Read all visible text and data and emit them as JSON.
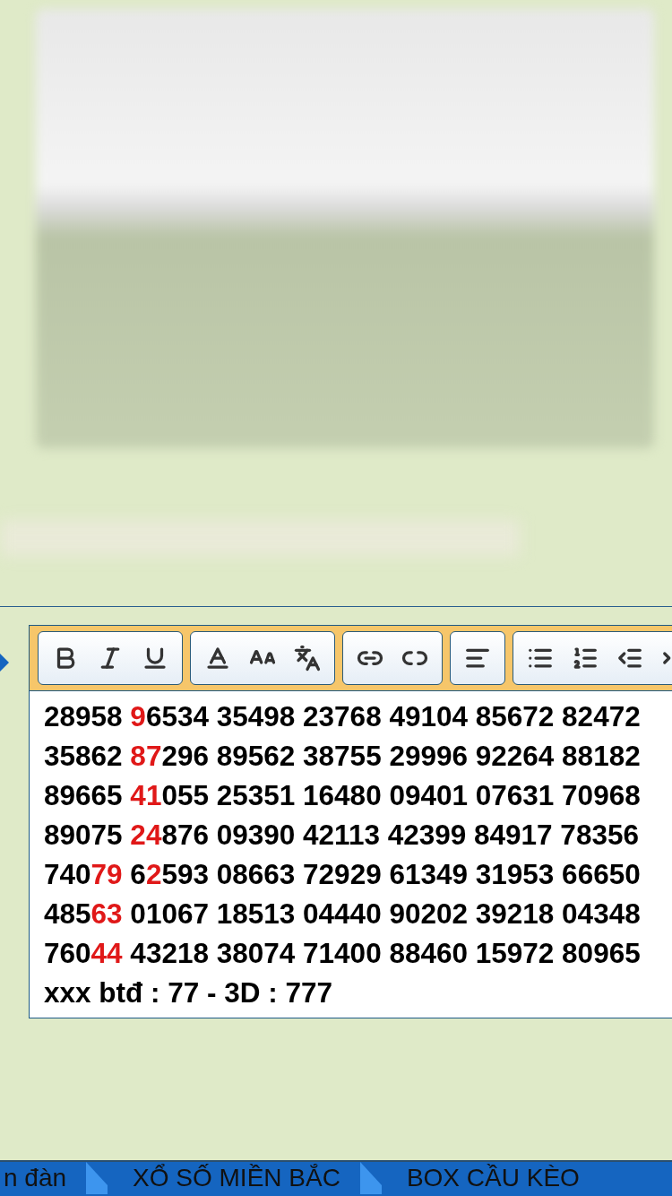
{
  "editor": {
    "lines": [
      [
        {
          "text": "28958 ",
          "highlight": false
        },
        {
          "text": "9",
          "highlight": true
        },
        {
          "text": "6534 35498 23768 49104 85672 82472",
          "highlight": false
        }
      ],
      [
        {
          "text": "35862 ",
          "highlight": false
        },
        {
          "text": "87",
          "highlight": true
        },
        {
          "text": "296 89562 38755 29996 92264 88182",
          "highlight": false
        }
      ],
      [
        {
          "text": "89665 ",
          "highlight": false
        },
        {
          "text": "41",
          "highlight": true
        },
        {
          "text": "055 25351 16480 09401 07631 70968",
          "highlight": false
        }
      ],
      [
        {
          "text": "89075 ",
          "highlight": false
        },
        {
          "text": "24",
          "highlight": true
        },
        {
          "text": "876 09390 42113 42399 84917 78356",
          "highlight": false
        }
      ],
      [
        {
          "text": "740",
          "highlight": false
        },
        {
          "text": "79",
          "highlight": true
        },
        {
          "text": " 6",
          "highlight": false
        },
        {
          "text": "2",
          "highlight": true
        },
        {
          "text": "593 08663 72929 61349 31953 66650",
          "highlight": false
        }
      ],
      [
        {
          "text": "485",
          "highlight": false
        },
        {
          "text": "63",
          "highlight": true
        },
        {
          "text": " 01067 18513 04440 90202 39218 04348",
          "highlight": false
        }
      ],
      [
        {
          "text": "760",
          "highlight": false
        },
        {
          "text": "44",
          "highlight": true
        },
        {
          "text": " 43218 38074 71400 88460 15972 80965",
          "highlight": false
        }
      ],
      [
        {
          "text": "xxx btđ : 77 - 3D : 777",
          "highlight": false
        }
      ]
    ]
  },
  "bottom_nav": [
    "n đàn",
    "XỔ SỐ MIỀN BẮC",
    "BOX CẦU KÈO"
  ]
}
